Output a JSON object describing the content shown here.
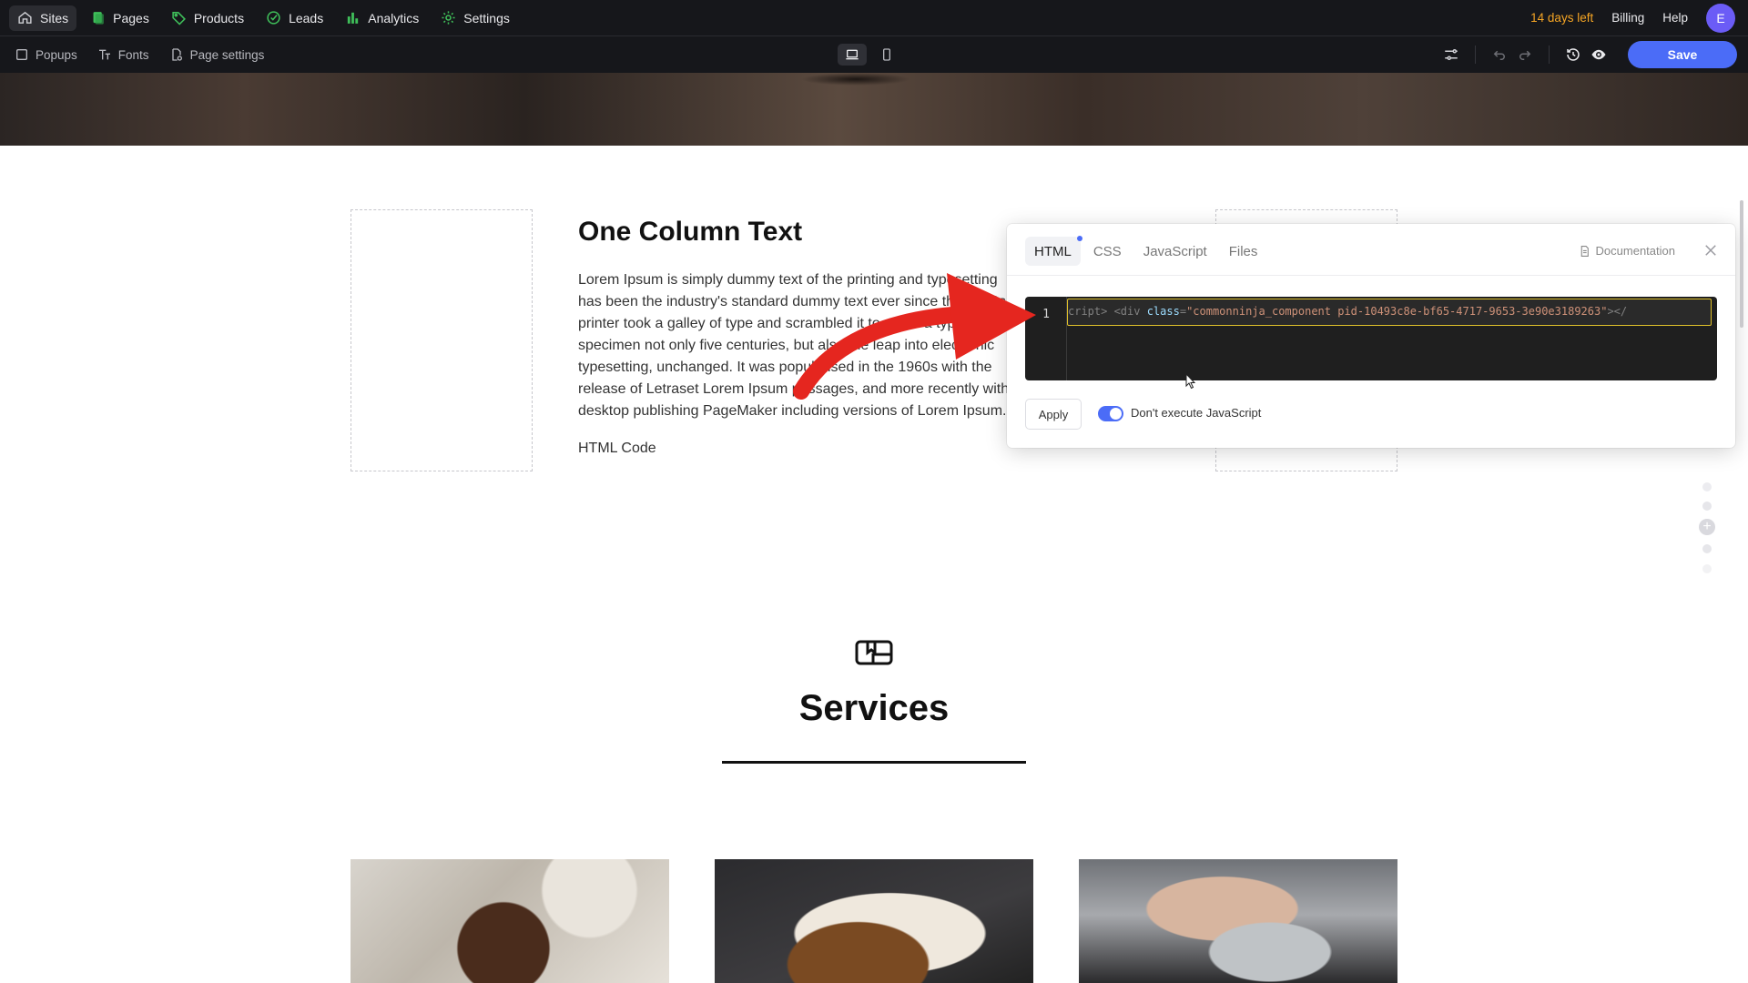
{
  "topnav": {
    "items": [
      {
        "label": "Sites",
        "icon": "home-icon",
        "active": true
      },
      {
        "label": "Pages",
        "icon": "pages-icon"
      },
      {
        "label": "Products",
        "icon": "tag-icon"
      },
      {
        "label": "Leads",
        "icon": "target-icon"
      },
      {
        "label": "Analytics",
        "icon": "bar-chart-icon"
      },
      {
        "label": "Settings",
        "icon": "gear-icon"
      }
    ],
    "trial": "14 days left",
    "billing": "Billing",
    "help": "Help",
    "avatar_initial": "E",
    "accent_color": "#4b6cf7"
  },
  "toolbar": {
    "popups": "Popups",
    "fonts": "Fonts",
    "page_settings": "Page settings",
    "save_label": "Save"
  },
  "content": {
    "heading": "One Column Text",
    "paragraph": "Lorem Ipsum is simply dummy text of the printing and typesetting has been the industry's standard dummy text ever since the 1500s, printer took a galley of type and scrambled it to make a type specimen not only five centuries, but also the leap into electronic typesetting, unchanged. It was popularised in the 1960s with the release of Letraset Lorem Ipsum passages, and more recently with desktop publishing PageMaker including versions of Lorem Ipsum.",
    "html_code_label": "HTML Code"
  },
  "editor": {
    "tabs": [
      "HTML",
      "CSS",
      "JavaScript",
      "Files"
    ],
    "active_tab": "HTML",
    "documentation": "Documentation",
    "line_number": "1",
    "code": {
      "pre": "cript> <div ",
      "attr": "class",
      "eq": "=",
      "value": "\"commonninja_component pid-10493c8e-bf65-4717-9653-3e90e3189263\"",
      "post": "></"
    },
    "apply_label": "Apply",
    "toggle_label": "Don't execute JavaScript",
    "toggle_on": true
  },
  "services": {
    "title": "Services"
  }
}
